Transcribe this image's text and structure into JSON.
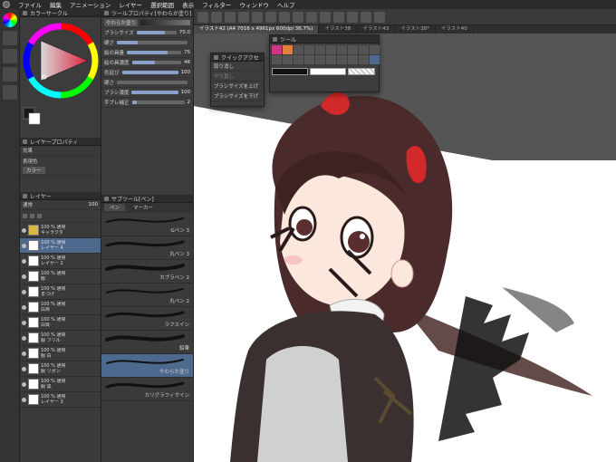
{
  "menu": [
    "ファイル",
    "編集",
    "アニメーション",
    "レイヤー",
    "選択範囲",
    "表示",
    "フィルター",
    "ウィンドウ",
    "ヘルプ"
  ],
  "color_panel": {
    "title": "カラーサークル"
  },
  "tool_property": {
    "title": "ツールプロパティ[やわらか塗り]",
    "tool_name": "やわらか塗り",
    "params": [
      {
        "label": "ブラシサイズ",
        "value": "70.0",
        "fraction": 0.7
      },
      {
        "label": "硬さ",
        "value": "",
        "fraction": 0.3
      },
      {
        "label": "絵の具量",
        "value": "75",
        "fraction": 0.75
      },
      {
        "label": "絵の具濃度",
        "value": "46",
        "fraction": 0.46
      },
      {
        "label": "色延び",
        "value": "100",
        "fraction": 1.0
      },
      {
        "label": "硬さ",
        "value": "",
        "fraction": 0.0
      },
      {
        "label": "ブラシ濃度",
        "value": "100",
        "fraction": 1.0
      },
      {
        "label": "手ブレ補正",
        "value": "2",
        "fraction": 0.1
      }
    ]
  },
  "layer_property": {
    "title": "レイヤープロパティ",
    "effect_label": "効果",
    "display_color_label": "表現色",
    "display_color_value": "カラー"
  },
  "layers_panel": {
    "title": "レイヤー",
    "blend": "通常",
    "opacity": "100",
    "layers": [
      {
        "line1": "100 % 通常",
        "line2": "キャラクタ",
        "folder": true
      },
      {
        "line1": "100 % 通常",
        "line2": "レイヤー 4",
        "selected": true
      },
      {
        "line1": "100 % 通常",
        "line2": "レイヤー 2"
      },
      {
        "line1": "100 % 通常",
        "line2": "眼"
      },
      {
        "line1": "100 % 通常",
        "line2": "まつげ"
      },
      {
        "line1": "100 % 通常",
        "line2": "白目"
      },
      {
        "line1": "100 % 通常",
        "line2": "白目"
      },
      {
        "line1": "100 % 通常",
        "line2": "服 フリル"
      },
      {
        "line1": "100 % 通常",
        "line2": "服 白"
      },
      {
        "line1": "100 % 通常",
        "line2": "服 リボン"
      },
      {
        "line1": "100 % 通常",
        "line2": "服 黒"
      },
      {
        "line1": "100 % 通常",
        "line2": "レイヤー 3"
      }
    ]
  },
  "subtool": {
    "title": "サブツール[ペン]",
    "tabs": [
      "ペン",
      "マーカー"
    ],
    "brushes": [
      "Gペン 3",
      "丸ペン 3",
      "カブラペン 2",
      "丸ペン 2",
      "ラフスイン",
      "鉛筆",
      "やわらか塗り",
      "カリグラフィサイン"
    ],
    "selected_index": 6
  },
  "doc_tabs": [
    "イラスト42 (A4 7016 x 4961px 600dpi 36.7%)",
    "イラスト38",
    "イラスト43",
    "イラスト38*",
    "イラスト40"
  ],
  "quick_access": {
    "title": "クイックアクセ",
    "items": [
      "取り消し",
      "やり直し",
      "ブラシサイズを上げ",
      "ブラシサイズを下げ"
    ]
  },
  "tool_popup": {
    "title": "ツール"
  },
  "colors": {
    "accent": "#4d6a8e",
    "hair": "#4a2a2a",
    "bow": "#d22a2a",
    "dress": "#3a3030",
    "skin": "#fbe7dc"
  }
}
